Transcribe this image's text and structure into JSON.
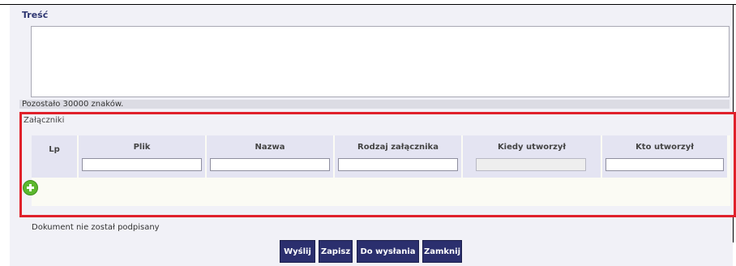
{
  "content": {
    "label": "Treść",
    "value": "",
    "counter_text": "Pozostało 30000 znaków."
  },
  "attachments": {
    "section_label": "Załączniki",
    "columns": [
      "Lp",
      "Plik",
      "Nazwa",
      "Rodzaj załącznika",
      "Kiedy utworzył",
      "Kto utworzył"
    ],
    "new_row": {
      "plik": "",
      "nazwa": "",
      "rodzaj": "",
      "kiedy": "",
      "kto": ""
    },
    "add_icon": "plus-circle-icon"
  },
  "signature_status": "Dokument nie został podpisany",
  "actions": {
    "send": "Wyślij",
    "save": "Zapisz",
    "to_send": "Do wysłania",
    "close": "Zamknij"
  },
  "colors": {
    "highlight_border": "#e0212b",
    "button_bg": "#2b2f6e",
    "add_icon": "#5cb82e"
  }
}
